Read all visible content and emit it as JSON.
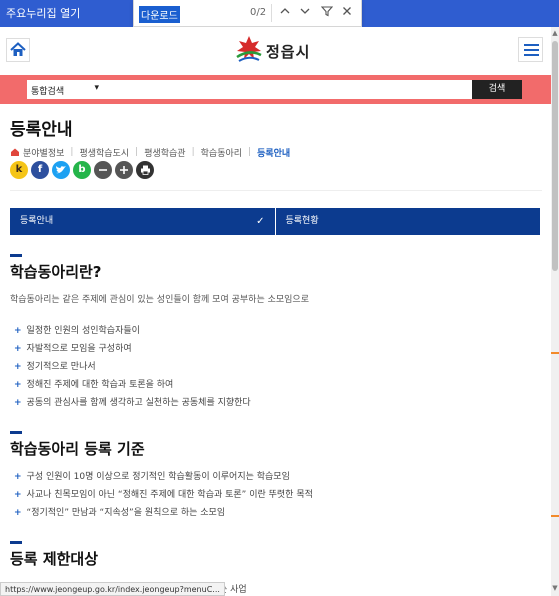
{
  "topbar": {
    "quick_links": "주요누리집 열기"
  },
  "findbar": {
    "query": "다운로드",
    "count": "0/2"
  },
  "header": {
    "logo_text": "정읍시"
  },
  "search": {
    "scope": "통합검색",
    "button": "검색",
    "placeholder": ""
  },
  "page": {
    "title": "등록안내"
  },
  "breadcrumb": [
    "분야별정보",
    "평생학습도시",
    "평생학습관",
    "학습동아리",
    "등록안내"
  ],
  "share": {
    "kakao": "k",
    "facebook": "f",
    "band": "b"
  },
  "tabs": {
    "active": "등록안내",
    "other": "등록현황"
  },
  "sections": [
    {
      "title": "학습동아리란?",
      "desc": "학습동아리는 같은 주제에 관심이 있는 성인들이 함께 모여 공부하는 소모임으로",
      "items": [
        "일정한 인원의 성인학습자들이",
        "자발적으로 모임을 구성하여",
        "정기적으로 만나서",
        "정해진 주제에 대한 학습과 토론을 하여",
        "공동의 관심사를 함께 생각하고 실천하는 공동체를 지향한다"
      ]
    },
    {
      "title": "학습동아리 등록 기준",
      "items": [
        "구성 인원이 10명 이상으로 정기적인 학습활동이 이루어지는 학습모임",
        "사교나 친목모임이 아닌 “정해진 주제에 대한 학습과 토론” 이란 뚜렷한 목적",
        "“정기적인” 만남과 “지속성”을 원칙으로 하는 소모임"
      ]
    },
    {
      "title": "등록 제한대상",
      "partial": "적으로 하는 사업"
    }
  ],
  "status": {
    "url": "https://www.jeongeup.go.kr/index.jeongeup?menuC..."
  },
  "colors": {
    "topbar": "#2f5dd0",
    "search_band": "#f26b6b",
    "tabs": "#0c3b8f",
    "accent": "#1d5fc1"
  }
}
